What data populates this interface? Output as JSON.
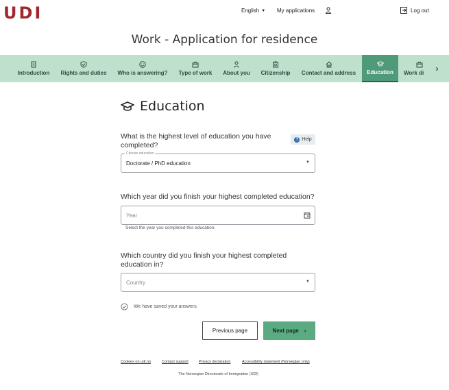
{
  "header": {
    "logo": "UDI",
    "language_label": "English",
    "my_applications_label": "My applications",
    "logout_label": "Log out"
  },
  "page_title": "Work - Application for residence",
  "steps": [
    {
      "label": "Introduction",
      "icon": "clipboard-icon"
    },
    {
      "label": "Rights and duties",
      "icon": "shield-check-icon"
    },
    {
      "label": "Who is answering?",
      "icon": "smiley-icon"
    },
    {
      "label": "Type of work",
      "icon": "briefcase-icon"
    },
    {
      "label": "About you",
      "icon": "person-icon"
    },
    {
      "label": "Citizenship",
      "icon": "passport-icon"
    },
    {
      "label": "Contact and address",
      "icon": "house-icon"
    },
    {
      "label": "Education",
      "icon": "graduation-cap-icon",
      "active": true
    },
    {
      "label": "Work di",
      "icon": "briefcase-icon"
    }
  ],
  "section": {
    "title": "Education"
  },
  "questions": {
    "q1": {
      "label_line1": "What is the highest level of education you have",
      "label_line2": "completed?",
      "help_label": "Help",
      "field_label": "Choose education",
      "value": "Doctorate / PhD education"
    },
    "q2": {
      "label": "Which year did you finish your highest completed education?",
      "placeholder": "Year",
      "hint": "Select the year you completed this education."
    },
    "q3": {
      "label_line1": "Which country did you finish your highest completed",
      "label_line2": "education in?",
      "placeholder": "Country"
    }
  },
  "saved_message": "We have saved your answers.",
  "buttons": {
    "previous": "Previous page",
    "next": "Next page"
  },
  "footer": {
    "links": [
      "Cookies on udi.no",
      "Contact support",
      "Privacy declaration",
      "Accessibility statement (Norwegian only)"
    ],
    "organization": "The Norwegian Directorate of Immigration (UDI)"
  },
  "colors": {
    "brand_red": "#a1282e",
    "nav_bg": "#bfe0cc",
    "nav_active": "#4f9a78",
    "primary_button": "#5aaa82"
  }
}
